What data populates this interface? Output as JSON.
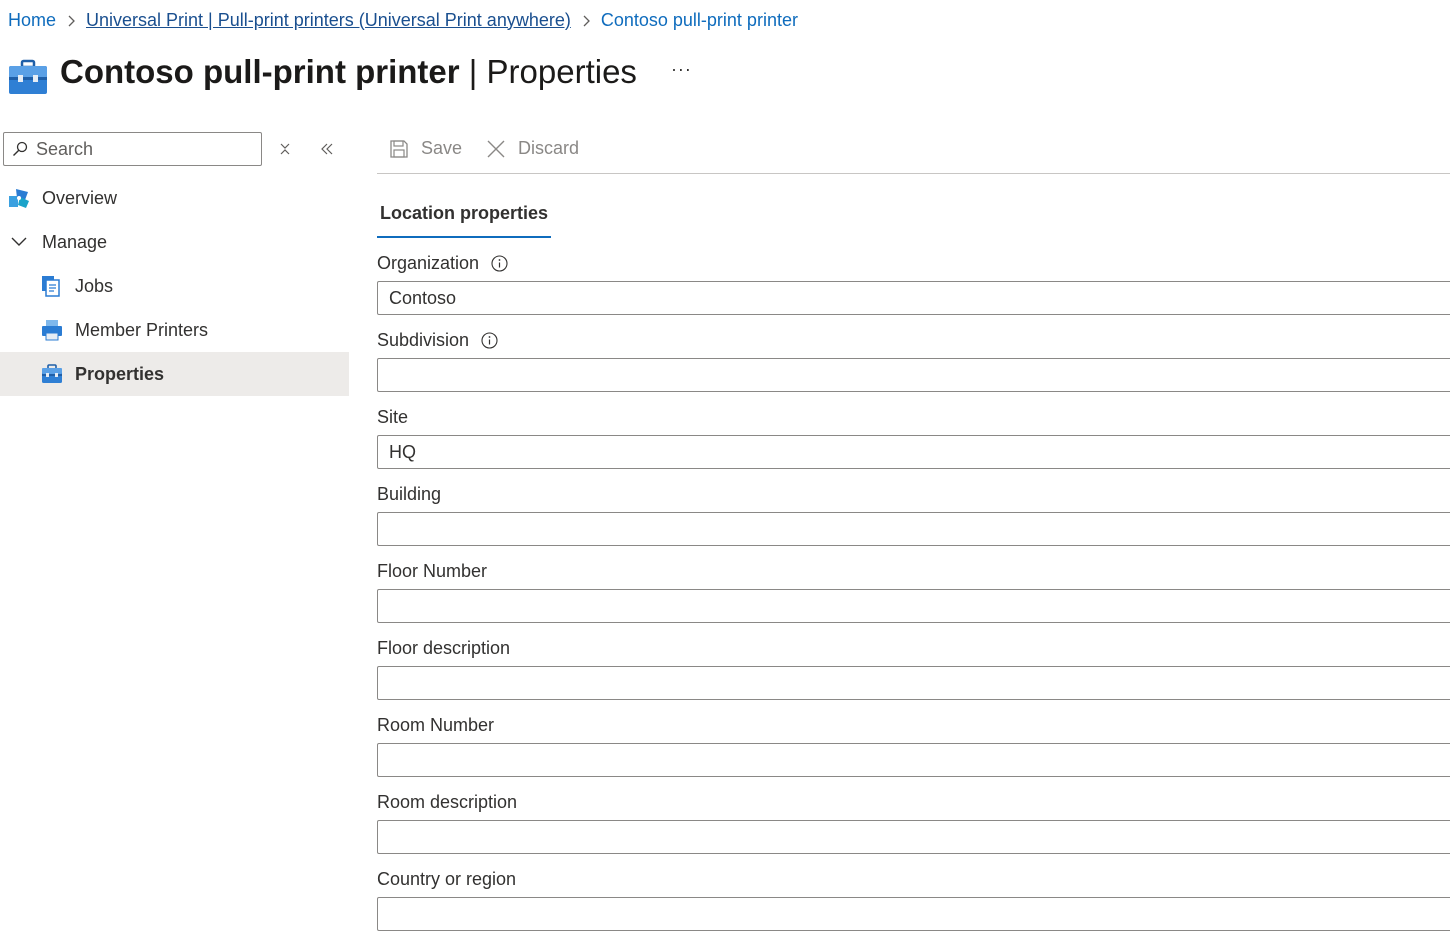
{
  "breadcrumb": [
    {
      "label": "Home"
    },
    {
      "label": "Universal Print | Pull-print printers (Universal Print anywhere)"
    },
    {
      "label": "Contoso pull-print printer"
    }
  ],
  "header": {
    "title_main": "Contoso pull-print printer",
    "title_separator": " | ",
    "title_section": "Properties",
    "more": "···"
  },
  "sidebar": {
    "search_placeholder": "Search",
    "items": [
      {
        "label": "Overview",
        "icon": "overview-icon"
      },
      {
        "label": "Manage",
        "icon": "chevron-down-icon"
      },
      {
        "label": "Jobs",
        "icon": "jobs-icon"
      },
      {
        "label": "Member Printers",
        "icon": "printer-icon"
      },
      {
        "label": "Properties",
        "icon": "toolbox-icon",
        "selected": true
      }
    ]
  },
  "toolbar": {
    "save_label": "Save",
    "discard_label": "Discard"
  },
  "tabs": [
    {
      "label": "Location properties",
      "active": true
    }
  ],
  "fields": [
    {
      "label": "Organization",
      "value": "Contoso",
      "info": true
    },
    {
      "label": "Subdivision",
      "value": "",
      "info": true
    },
    {
      "label": "Site",
      "value": "HQ"
    },
    {
      "label": "Building",
      "value": ""
    },
    {
      "label": "Floor Number",
      "value": ""
    },
    {
      "label": "Floor description",
      "value": ""
    },
    {
      "label": "Room Number",
      "value": ""
    },
    {
      "label": "Room description",
      "value": ""
    },
    {
      "label": "Country or region",
      "value": ""
    }
  ],
  "colors": {
    "accent": "#0f6cbd",
    "selected_bg": "#edebe9",
    "border": "#8a8886"
  }
}
